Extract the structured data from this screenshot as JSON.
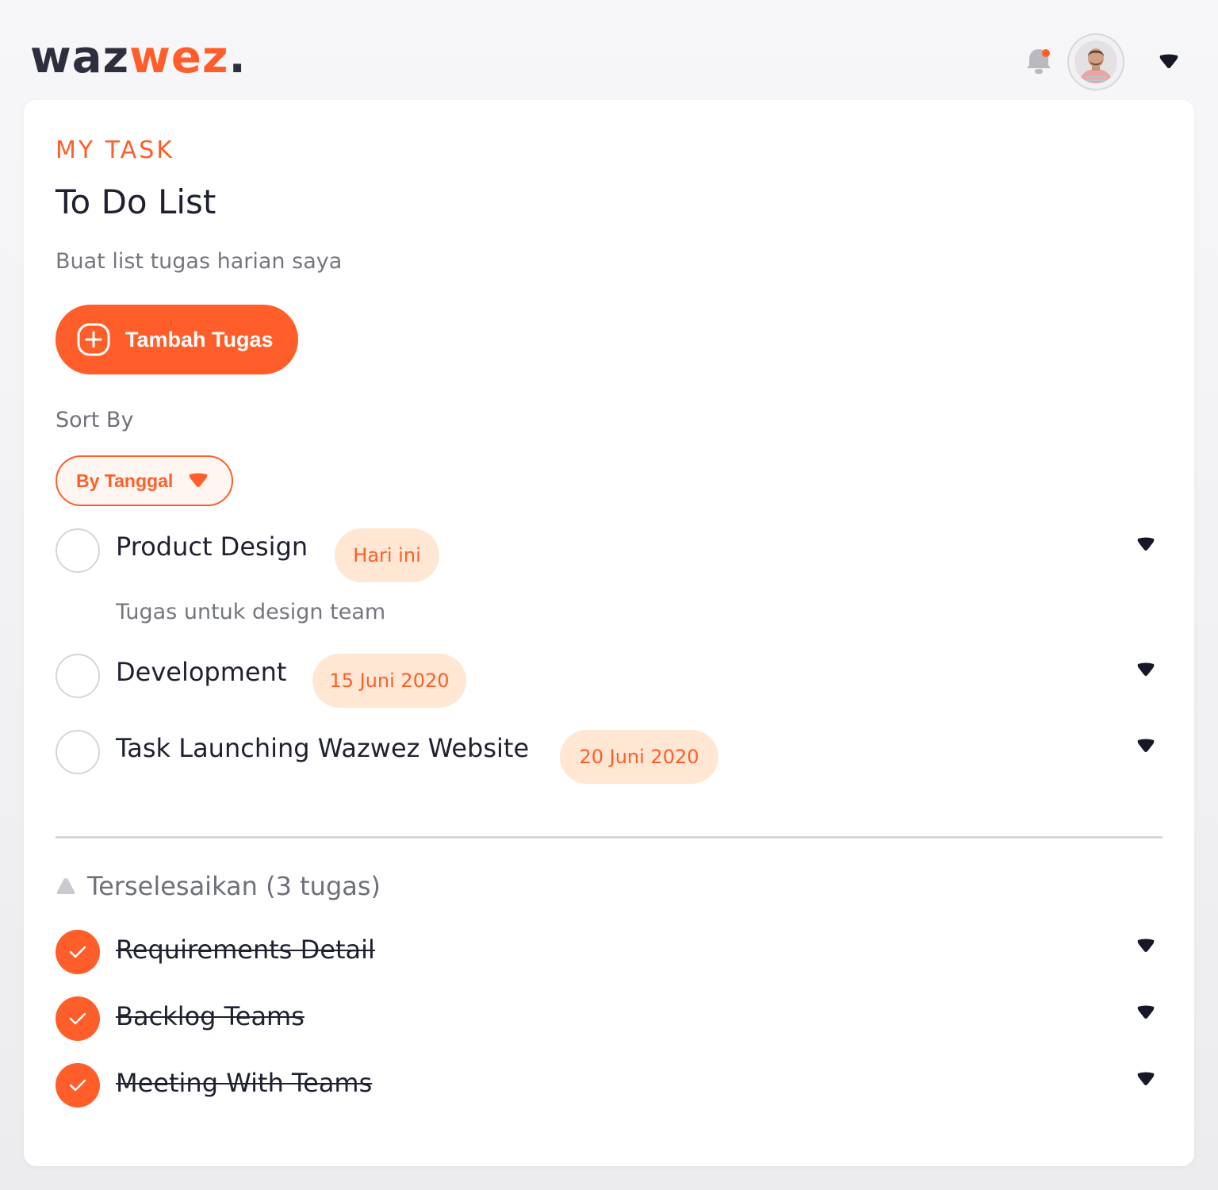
{
  "header": {
    "logo": {
      "part1": "waz",
      "part2": "wez",
      "part3": "."
    },
    "notification_icon": "bell-icon",
    "avatar_icon": "user-avatar",
    "menu_icon": "caret-down-icon"
  },
  "main": {
    "eyebrow": "MY TASK",
    "title": "To Do List",
    "subtitle": "Buat list tugas harian saya",
    "add_button": {
      "label": "Tambah Tugas",
      "icon": "plus-circle-icon"
    },
    "sort": {
      "label": "Sort By",
      "selected": "By Tanggal",
      "icon": "caret-down-icon"
    },
    "tasks": [
      {
        "title": "Product Design",
        "badge": "Hari ini",
        "description": "Tugas untuk design team"
      },
      {
        "title": "Development",
        "badge": "15 Juni 2020"
      },
      {
        "title": "Task Launching Wazwez Website",
        "badge": "20 Juni 2020"
      }
    ],
    "completed": {
      "label": "Terselesaikan (3 tugas)",
      "items": [
        {
          "title": "Requirements Detail"
        },
        {
          "title": "Backlog Teams"
        },
        {
          "title": "Meeting With Teams"
        }
      ]
    }
  },
  "colors": {
    "accent": "#ff5e2a",
    "badge_bg": "#ffe7d3",
    "text_dark": "#1f2130",
    "text_muted": "#75777f"
  }
}
